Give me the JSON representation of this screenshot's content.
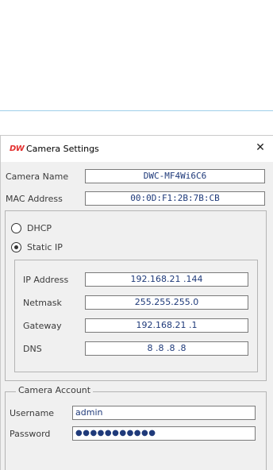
{
  "window": {
    "logo": "DW",
    "title": "Camera Settings",
    "close": "✕"
  },
  "camera": {
    "name_label": "Camera Name",
    "name_value": "DWC-MF4Wi6C6",
    "mac_label": "MAC Address",
    "mac_value": "00:0D:F1:2B:7B:CB"
  },
  "network": {
    "dhcp_label": "DHCP",
    "static_label": "Static IP",
    "selected_mode": "Static IP",
    "ip_label": "IP Address",
    "ip_value": "192.168.21 .144",
    "netmask_label": "Netmask",
    "netmask_value": "255.255.255.0",
    "gateway_label": "Gateway",
    "gateway_value": "192.168.21 .1",
    "dns_label": "DNS",
    "dns_value": "8  .8  .8  .8"
  },
  "account": {
    "group_label": "Camera Account",
    "username_label": "Username",
    "username_value": "admin",
    "password_label": "Password",
    "password_value": "●●●●●●●●●●●"
  },
  "colors": {
    "accent_line": "#9ecfe9",
    "logo_red": "#e3302f",
    "field_text": "#1f3a7a"
  }
}
